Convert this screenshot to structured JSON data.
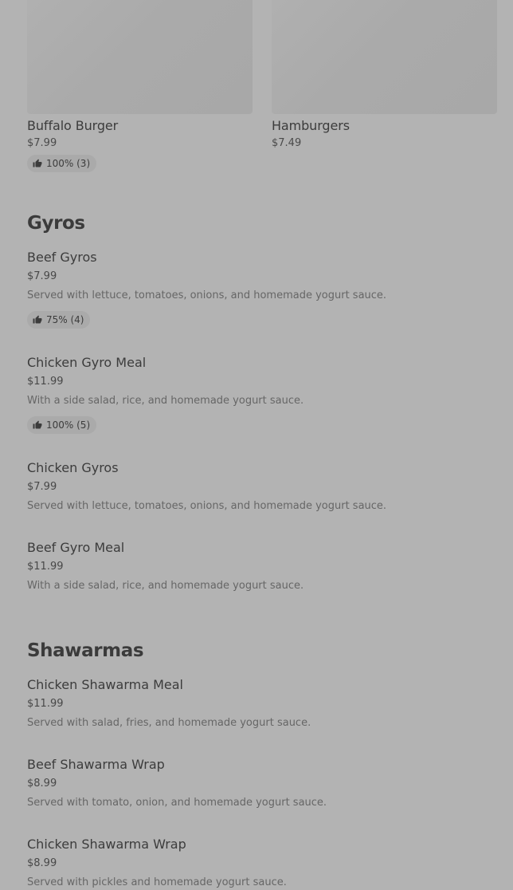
{
  "top_cards": [
    {
      "name": "Buffalo Burger",
      "price": "$7.99",
      "rating": "100% (3)"
    },
    {
      "name": "Hamburgers",
      "price": "$7.49"
    }
  ],
  "sections": [
    {
      "title": "Gyros",
      "items": [
        {
          "name": "Beef Gyros",
          "price": "$7.99",
          "description": "Served with lettuce, tomatoes, onions, and homemade yogurt sauce.",
          "rating": "75% (4)"
        },
        {
          "name": "Chicken Gyro Meal",
          "price": "$11.99",
          "description": "With a side salad, rice, and homemade yogurt sauce.",
          "rating": "100% (5)"
        },
        {
          "name": "Chicken Gyros",
          "price": "$7.99",
          "description": "Served with lettuce, tomatoes, onions, and homemade yogurt sauce."
        },
        {
          "name": "Beef Gyro Meal",
          "price": "$11.99",
          "description": "With a side salad, rice, and homemade yogurt sauce."
        }
      ]
    },
    {
      "title": "Shawarmas",
      "items": [
        {
          "name": "Chicken Shawarma Meal",
          "price": "$11.99",
          "description": "Served with salad, fries, and homemade yogurt sauce."
        },
        {
          "name": "Beef Shawarma Wrap",
          "price": "$8.99",
          "description": "Served with tomato, onion, and homemade yogurt sauce."
        },
        {
          "name": "Chicken Shawarma Wrap",
          "price": "$8.99",
          "description": "Served with pickles and homemade yogurt sauce."
        }
      ]
    }
  ],
  "icons": {
    "rating": "thumbs-up-icon"
  }
}
